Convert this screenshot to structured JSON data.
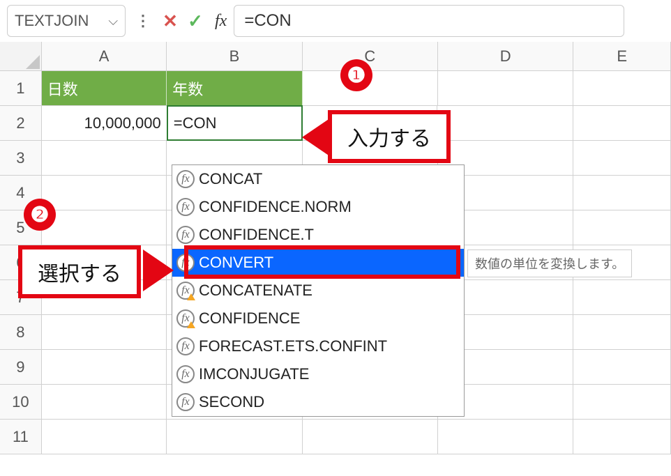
{
  "formula_bar": {
    "name_box": "TEXTJOIN",
    "formula": "=CON"
  },
  "columns": [
    "A",
    "B",
    "C",
    "D",
    "E"
  ],
  "rows": {
    "r1": {
      "A": "日数",
      "B": "年数"
    },
    "r2": {
      "A": "10,000,000",
      "B": "=CON"
    }
  },
  "row_numbers": [
    "1",
    "2",
    "3",
    "4",
    "5",
    "6",
    "7",
    "8",
    "9",
    "10",
    "11"
  ],
  "autocomplete": {
    "items": [
      {
        "label": "CONCAT",
        "warn": false
      },
      {
        "label": "CONFIDENCE.NORM",
        "warn": false
      },
      {
        "label": "CONFIDENCE.T",
        "warn": false
      },
      {
        "label": "CONVERT",
        "warn": false,
        "selected": true
      },
      {
        "label": "CONCATENATE",
        "warn": true
      },
      {
        "label": "CONFIDENCE",
        "warn": true
      },
      {
        "label": "FORECAST.ETS.CONFINT",
        "warn": false
      },
      {
        "label": "IMCONJUGATE",
        "warn": false
      },
      {
        "label": "SECOND",
        "warn": false
      }
    ],
    "tooltip": "数値の単位を変換します。"
  },
  "annotations": {
    "badge1": "❶",
    "badge2": "❷",
    "callout1": "入力する",
    "callout2": "選択する"
  }
}
